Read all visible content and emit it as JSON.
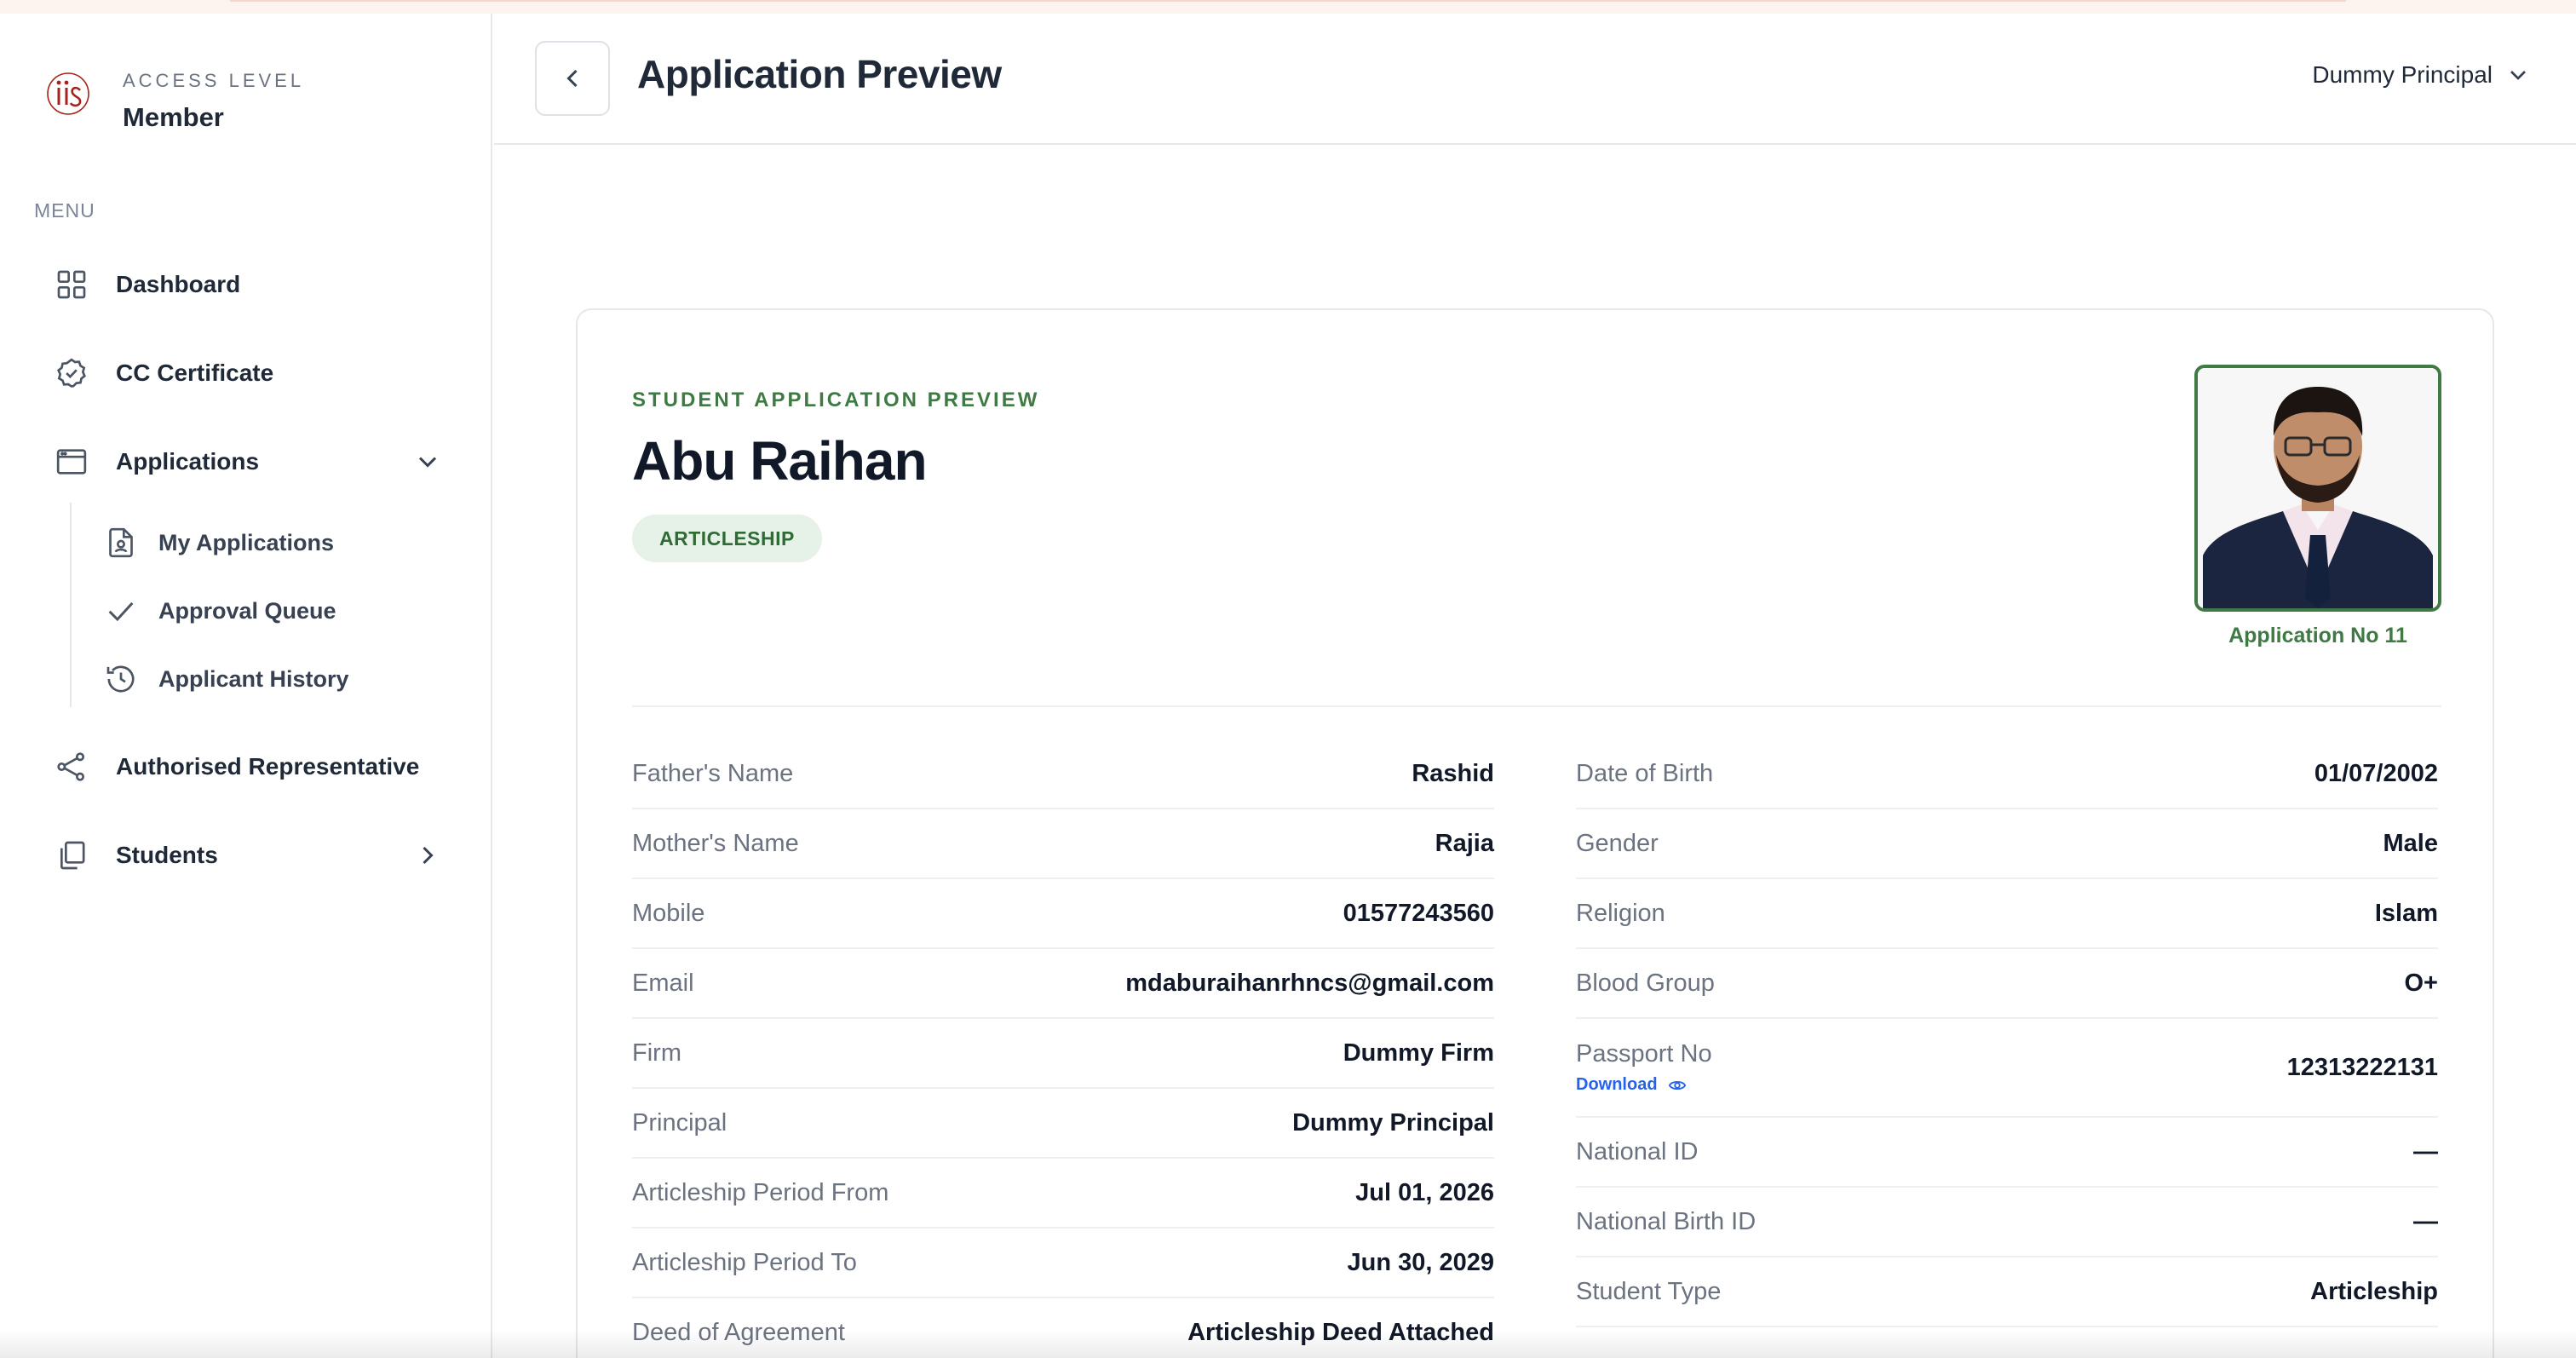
{
  "colors": {
    "accent_green": "#3f7a44",
    "badge_bg": "#e6f1e7",
    "link_blue": "#2563eb",
    "brand_red": "#a5231b"
  },
  "sidebar": {
    "access_label": "ACCESS LEVEL",
    "access_value": "Member",
    "menu_label": "MENU",
    "items": [
      {
        "label": "Dashboard",
        "icon": "grid-icon"
      },
      {
        "label": "CC Certificate",
        "icon": "badge-check-icon"
      },
      {
        "label": "Applications",
        "icon": "window-icon",
        "expanded": true,
        "children": [
          {
            "label": "My Applications",
            "icon": "file-user-icon"
          },
          {
            "label": "Approval Queue",
            "icon": "check-icon"
          },
          {
            "label": "Applicant History",
            "icon": "history-icon"
          }
        ]
      },
      {
        "label": "Authorised Representative",
        "icon": "share-nodes-icon"
      },
      {
        "label": "Students",
        "icon": "copy-icon",
        "expanded": false
      }
    ]
  },
  "header": {
    "title": "Application Preview",
    "user": "Dummy Principal"
  },
  "card": {
    "eyebrow": "STUDENT APPLICATION PREVIEW",
    "name": "Abu Raihan",
    "badge": "ARTICLESHIP",
    "application_no": "Application No 11",
    "left_fields": [
      {
        "label": "Father's Name",
        "value": "Rashid"
      },
      {
        "label": "Mother's Name",
        "value": "Rajia"
      },
      {
        "label": "Mobile",
        "value": "01577243560"
      },
      {
        "label": "Email",
        "value": "mdaburaihanrhncs@gmail.com"
      },
      {
        "label": "Firm",
        "value": "Dummy Firm"
      },
      {
        "label": "Principal",
        "value": "Dummy Principal"
      },
      {
        "label": "Articleship Period From",
        "value": "Jul 01, 2026"
      },
      {
        "label": "Articleship Period To",
        "value": "Jun 30, 2029"
      },
      {
        "label": "Deed of Agreement",
        "value": "Articleship Deed Attached"
      }
    ],
    "right_fields": [
      {
        "label": "Date of Birth",
        "value": "01/07/2002"
      },
      {
        "label": "Gender",
        "value": "Male"
      },
      {
        "label": "Religion",
        "value": "Islam"
      },
      {
        "label": "Blood Group",
        "value": "O+"
      },
      {
        "label": "Passport No",
        "value": "12313222131",
        "link": "Download"
      },
      {
        "label": "National ID",
        "value": "—"
      },
      {
        "label": "National Birth ID",
        "value": "—"
      },
      {
        "label": "Student Type",
        "value": "Articleship"
      }
    ]
  }
}
